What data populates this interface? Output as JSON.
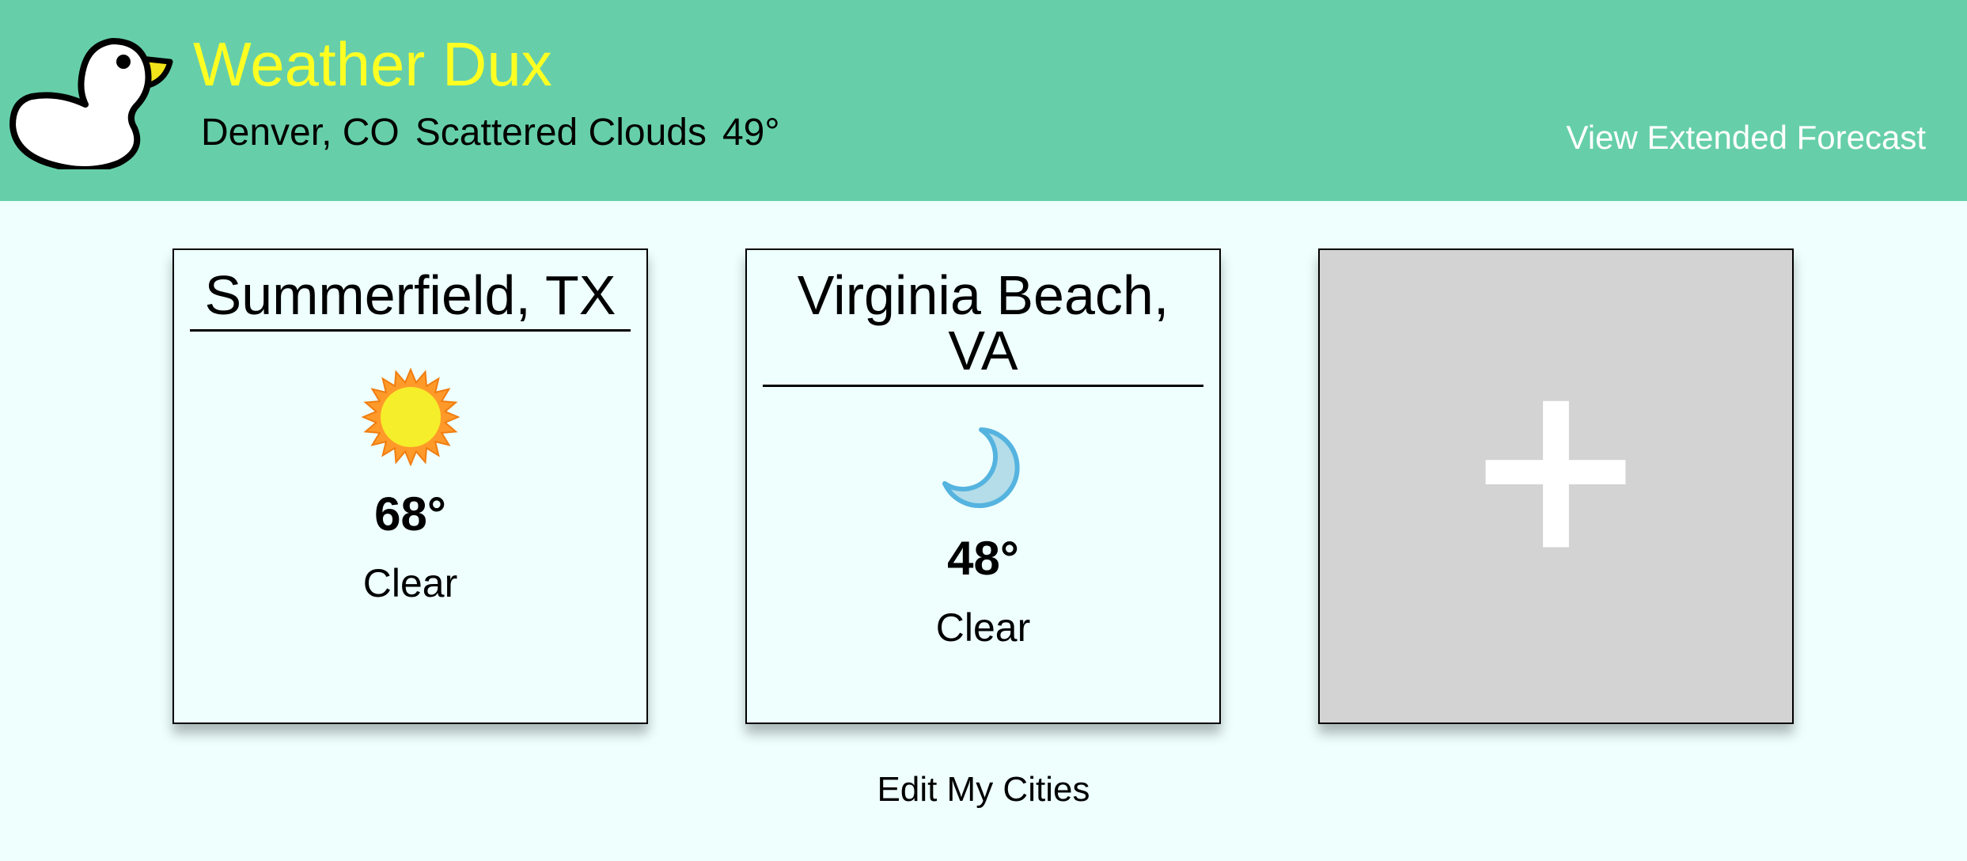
{
  "app": {
    "title": "Weather Dux"
  },
  "current": {
    "location": "Denver, CO",
    "condition": "Scattered Clouds",
    "temperature": "49°"
  },
  "header": {
    "extended_forecast_label": "View Extended Forecast"
  },
  "cities": [
    {
      "name": "Summerfield, TX",
      "icon": "sun-icon",
      "temperature": "68°",
      "condition": "Clear"
    },
    {
      "name": "Virginia Beach, VA",
      "icon": "moon-icon",
      "temperature": "48°",
      "condition": "Clear"
    }
  ],
  "add_city": {
    "icon": "plus-icon"
  },
  "footer": {
    "edit_label": "Edit My Cities"
  },
  "colors": {
    "header_background": "#66cfaa",
    "title_color": "#ffff22",
    "page_background": "#eefffe",
    "add_card_background": "#d3d3d3"
  }
}
